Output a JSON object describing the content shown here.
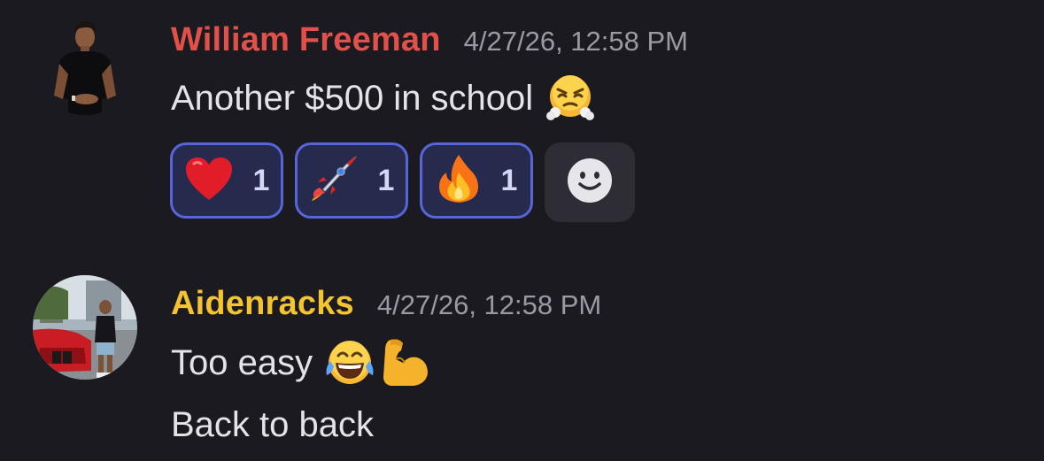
{
  "messages": [
    {
      "author": "William Freeman",
      "author_color": "#e2504a",
      "timestamp": "4/27/26, 12:58 PM",
      "text": "Another $500 in school",
      "emoji": "face-with-steam-from-nose",
      "reactions": [
        {
          "icon": "heart-icon",
          "count": "1"
        },
        {
          "icon": "rocket-icon",
          "count": "1"
        },
        {
          "icon": "fire-icon",
          "count": "1"
        }
      ],
      "add_reaction_icon": "smiley-icon"
    },
    {
      "author": "Aidenracks",
      "author_color": "#f3c430",
      "timestamp": "4/27/26, 12:58 PM",
      "lines": [
        {
          "text": "Too easy",
          "emojis": [
            "tears-of-joy-face",
            "flexed-biceps"
          ]
        },
        {
          "text": "Back to back"
        }
      ]
    }
  ],
  "colors": {
    "background": "#1b1a20",
    "reaction_border": "#5865d8",
    "reaction_bg": "#262a4d",
    "timestamp": "#9a9aa3"
  }
}
